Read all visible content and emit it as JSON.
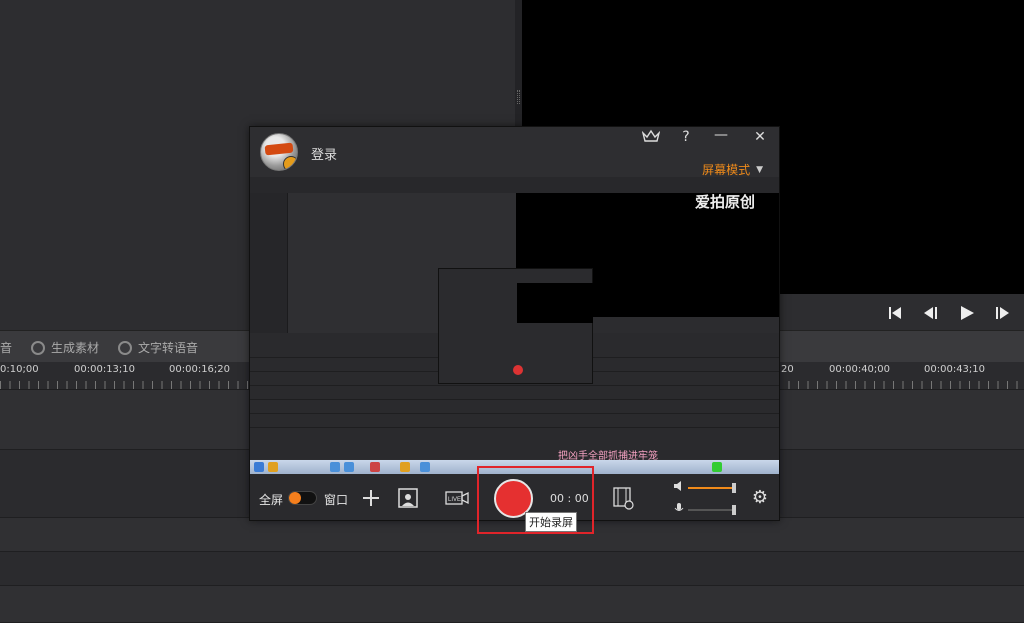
{
  "editor": {
    "toolbar": {
      "partial_label": "音",
      "generate_label": "生成素材",
      "tts_label": "文字转语音"
    },
    "ruler": [
      "0:10;00",
      "00:00:13;10",
      "00:00:16;20",
      "20",
      "00:00:40;00",
      "00:00:43;10"
    ]
  },
  "recorder": {
    "login_label": "登录",
    "vip_icon": "crown-icon",
    "help_label": "?",
    "minimize_label": "—",
    "close_label": "✕",
    "mode_label": "屏幕模式",
    "preview": {
      "logo_text": "爱拍原创",
      "caption": "把凶手全部抓捕进牢笼"
    },
    "bottom": {
      "fullscreen_label": "全屏",
      "window_label": "窗口",
      "timer": "00 : 00",
      "record_tooltip": "开始录屏"
    },
    "accent_color": "#f08a1a",
    "record_color": "#e53030"
  }
}
